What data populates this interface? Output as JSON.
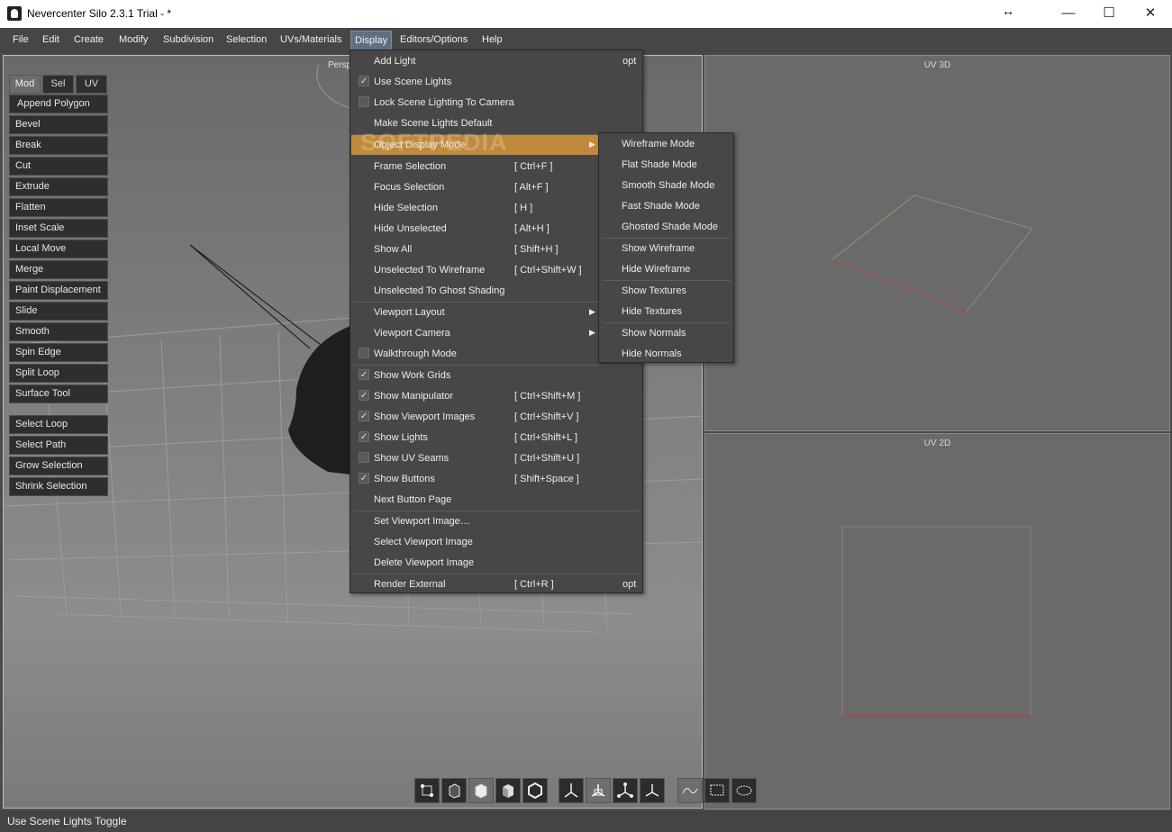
{
  "window": {
    "title": "Nevercenter Silo 2.3.1 Trial - *",
    "minimize": "—",
    "maximize": "☐",
    "close": "✕",
    "resize_icon": "↔"
  },
  "menubar": [
    "File",
    "Edit",
    "Create",
    "Modify",
    "Subdivision",
    "Selection",
    "UVs/Materials",
    "Display",
    "Editors/Options",
    "Help"
  ],
  "viewports": {
    "main_label": "Persp",
    "uv3d_label": "UV 3D",
    "uv2d_label": "UV 2D"
  },
  "tool_tabs": [
    "Mod",
    "Sel",
    "UV"
  ],
  "tool_buttons": [
    "Append Polygon",
    "Bevel",
    "Break",
    "Cut",
    "Extrude",
    "Flatten",
    "Inset Scale",
    "Local Move",
    "Merge",
    "Paint Displacement",
    "Slide",
    "Smooth",
    "Spin Edge",
    "Split Loop",
    "Surface Tool"
  ],
  "selection_buttons": [
    "Select Loop",
    "Select Path",
    "Grow Selection",
    "Shrink Selection"
  ],
  "display_menu": {
    "items": [
      {
        "label": "Add Light",
        "shortcut": "",
        "opt": "opt",
        "check": "none"
      },
      {
        "label": "Use Scene Lights",
        "shortcut": "",
        "opt": "",
        "check": "checked"
      },
      {
        "label": "Lock Scene Lighting To Camera",
        "shortcut": "",
        "opt": "",
        "check": "unchecked"
      },
      {
        "label": "Make Scene Lights Default",
        "shortcut": "",
        "opt": "",
        "check": "none"
      },
      {
        "label": "Object Display Mode",
        "shortcut": "",
        "opt": "",
        "check": "none",
        "submenu": true
      },
      {
        "label": "Frame Selection",
        "shortcut": "[ Ctrl+F ]",
        "opt": "",
        "check": "none"
      },
      {
        "label": "Focus Selection",
        "shortcut": "[ Alt+F ]",
        "opt": "",
        "check": "none"
      },
      {
        "label": "Hide Selection",
        "shortcut": "[ H ]",
        "opt": "",
        "check": "none"
      },
      {
        "label": "Hide Unselected",
        "shortcut": "[ Alt+H ]",
        "opt": "",
        "check": "none"
      },
      {
        "label": "Show All",
        "shortcut": "[ Shift+H ]",
        "opt": "",
        "check": "none"
      },
      {
        "label": "Unselected To Wireframe",
        "shortcut": "[ Ctrl+Shift+W ]",
        "opt": "",
        "check": "none"
      },
      {
        "label": "Unselected To Ghost Shading",
        "shortcut": "",
        "opt": "",
        "check": "none"
      },
      {
        "label": "Viewport Layout",
        "shortcut": "",
        "opt": "",
        "check": "none",
        "submenu": true
      },
      {
        "label": "Viewport Camera",
        "shortcut": "",
        "opt": "",
        "check": "none",
        "submenu": true
      },
      {
        "label": "Walkthrough Mode",
        "shortcut": "",
        "opt": "",
        "check": "unchecked"
      },
      {
        "label": "Show Work Grids",
        "shortcut": "",
        "opt": "",
        "check": "checked"
      },
      {
        "label": "Show Manipulator",
        "shortcut": "[ Ctrl+Shift+M ]",
        "opt": "",
        "check": "checked"
      },
      {
        "label": "Show Viewport Images",
        "shortcut": "[ Ctrl+Shift+V ]",
        "opt": "",
        "check": "checked"
      },
      {
        "label": "Show Lights",
        "shortcut": "[ Ctrl+Shift+L ]",
        "opt": "",
        "check": "checked"
      },
      {
        "label": "Show UV Seams",
        "shortcut": "[ Ctrl+Shift+U ]",
        "opt": "",
        "check": "unchecked"
      },
      {
        "label": "Show Buttons",
        "shortcut": "[ Shift+Space ]",
        "opt": "",
        "check": "checked"
      },
      {
        "label": "Next Button Page",
        "shortcut": "",
        "opt": "",
        "check": "none"
      },
      {
        "label": "Set Viewport Image…",
        "shortcut": "",
        "opt": "",
        "check": "none"
      },
      {
        "label": "Select Viewport Image",
        "shortcut": "",
        "opt": "",
        "check": "none"
      },
      {
        "label": "Delete Viewport Image",
        "shortcut": "",
        "opt": "",
        "check": "none"
      },
      {
        "label": "Render External",
        "shortcut": "[ Ctrl+R ]",
        "opt": "opt",
        "check": "none"
      }
    ]
  },
  "object_display_submenu": [
    "Wireframe Mode",
    "Flat Shade Mode",
    "Smooth Shade Mode",
    "Fast Shade Mode",
    "Ghosted Shade Mode",
    "Show Wireframe",
    "Hide Wireframe",
    "Show Textures",
    "Hide Textures",
    "Show Normals",
    "Hide Normals"
  ],
  "watermark": "SOFTPEDIA",
  "status": "Use Scene Lights Toggle",
  "colors": {
    "highlight": "#c08a3a",
    "menu_bg": "#474747",
    "active_menu": "#5f6f80"
  }
}
